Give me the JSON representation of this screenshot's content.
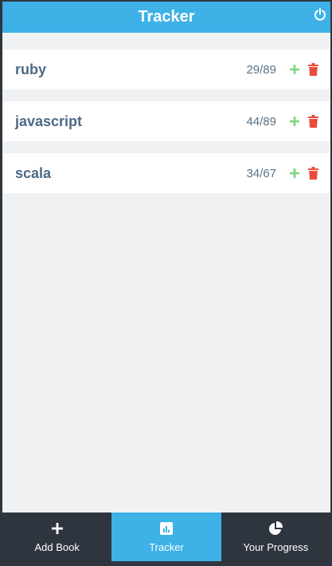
{
  "header": {
    "title": "Tracker"
  },
  "books": [
    {
      "title": "ruby",
      "progress": "29/89"
    },
    {
      "title": "javascript",
      "progress": "44/89"
    },
    {
      "title": "scala",
      "progress": "34/67"
    }
  ],
  "nav": {
    "items": [
      {
        "label": "Add Book",
        "icon": "plus-icon",
        "active": false
      },
      {
        "label": "Tracker",
        "icon": "bar-chart-icon",
        "active": true
      },
      {
        "label": "Your Progress",
        "icon": "pie-chart-icon",
        "active": false
      }
    ]
  },
  "colors": {
    "accent": "#3eb1e6",
    "dark": "#2f353e",
    "add": "#7ed47e",
    "delete": "#e84c3d"
  }
}
